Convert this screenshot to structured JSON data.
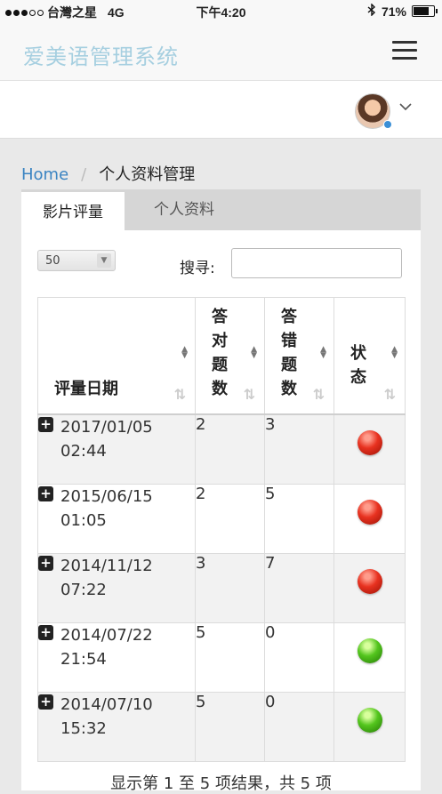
{
  "status_bar": {
    "carrier": "台灣之星",
    "network": "4G",
    "time": "下午4:20",
    "battery": "71%"
  },
  "header": {
    "brand": "爱美语管理系统"
  },
  "breadcrumb": {
    "home": "Home",
    "separator": "/",
    "current": "个人资料管理"
  },
  "tabs": [
    {
      "label": "影片评量",
      "active": true
    },
    {
      "label": "个人资料",
      "active": false
    }
  ],
  "table_controls": {
    "page_length": "50",
    "search_label": "搜寻:",
    "search_value": ""
  },
  "table": {
    "columns": [
      "评量日期",
      "答\n对\n题\n数",
      "答\n错\n题\n数",
      "状\n态"
    ],
    "rows": [
      {
        "date": "2017/01/05",
        "time": "02:44",
        "correct": "2",
        "wrong": "3",
        "status": "red"
      },
      {
        "date": "2015/06/15",
        "time": "01:05",
        "correct": "2",
        "wrong": "5",
        "status": "red"
      },
      {
        "date": "2014/11/12",
        "time": "07:22",
        "correct": "3",
        "wrong": "7",
        "status": "red"
      },
      {
        "date": "2014/07/22",
        "time": "21:54",
        "correct": "5",
        "wrong": "0",
        "status": "green"
      },
      {
        "date": "2014/07/10",
        "time": "15:32",
        "correct": "5",
        "wrong": "0",
        "status": "green"
      }
    ]
  },
  "table_info": "显示第 1 至 5 项结果，共 5 项",
  "colors": {
    "brand": "#a6cfe0",
    "link": "#3a84c2",
    "status_red": "#e83220",
    "status_green": "#53c51d"
  }
}
